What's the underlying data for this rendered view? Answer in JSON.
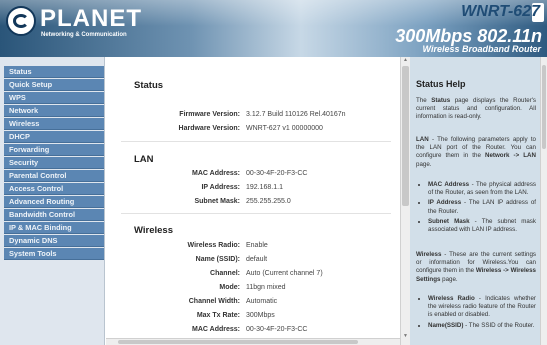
{
  "header": {
    "brand": "PLANET",
    "brand_sub": "Networking & Communication",
    "model": "WNRT-627",
    "speed": "300Mbps 802.11n",
    "speed_sub": "Wireless Broadband Router"
  },
  "nav": {
    "items": [
      "Status",
      "Quick Setup",
      "WPS",
      "Network",
      "Wireless",
      "DHCP",
      "Forwarding",
      "Security",
      "Parental Control",
      "Access Control",
      "Advanced Routing",
      "Bandwidth Control",
      "IP & MAC Binding",
      "Dynamic DNS",
      "System Tools"
    ]
  },
  "status": {
    "title": "Status",
    "firmware_label": "Firmware Version:",
    "firmware_value": "3.12.7 Build 110126 Rel.40167n",
    "hardware_label": "Hardware Version:",
    "hardware_value": "WNRT-627 v1 00000000"
  },
  "lan": {
    "title": "LAN",
    "rows": [
      {
        "label": "MAC Address:",
        "value": "00-30-4F-20-F3-CC"
      },
      {
        "label": "IP Address:",
        "value": "192.168.1.1"
      },
      {
        "label": "Subnet Mask:",
        "value": "255.255.255.0"
      }
    ]
  },
  "wireless": {
    "title": "Wireless",
    "rows": [
      {
        "label": "Wireless Radio:",
        "value": "Enable"
      },
      {
        "label": "Name (SSID):",
        "value": "default"
      },
      {
        "label": "Channel:",
        "value": "Auto (Current channel 7)"
      },
      {
        "label": "Mode:",
        "value": "11bgn mixed"
      },
      {
        "label": "Channel Width:",
        "value": "Automatic"
      },
      {
        "label": "Max Tx Rate:",
        "value": "300Mbps"
      },
      {
        "label": "MAC Address:",
        "value": "00-30-4F-20-F3-CC"
      }
    ]
  },
  "help": {
    "title": "Status Help",
    "p1_bold": "Status",
    "p1_pre": "The ",
    "p1_post": " page displays the Router's current status and configuration. All information is read-only.",
    "p2_bold": "LAN",
    "p2_post": " - The following parameters apply to the LAN port of the Router. You can configure them in the ",
    "p2_link": "Network -> LAN",
    "p2_end": " page.",
    "lan_items": [
      {
        "bold": "MAC Address",
        "text": " - The physical address of the Router, as seen from the LAN."
      },
      {
        "bold": "IP Address",
        "text": " - The LAN IP address of the Router."
      },
      {
        "bold": "Subnet Mask",
        "text": " - The subnet mask associated with LAN IP address."
      }
    ],
    "p3_bold": "Wireless",
    "p3_post": " - These are the current settings or information for Wireless.You can configure them in the ",
    "p3_link": "Wireless -> Wireless Settings",
    "p3_end": " page.",
    "wl_items": [
      {
        "bold": "Wireless Radio",
        "text": " - Indicates whether the wireless radio feature of the Router is enabled or disabled."
      },
      {
        "bold": "Name(SSID)",
        "text": " - The SSID of the Router."
      }
    ]
  },
  "colors": {
    "nav_item": "#5b86b3",
    "help_bg": "#d2dfe9",
    "header_dark": "#2a5579"
  }
}
